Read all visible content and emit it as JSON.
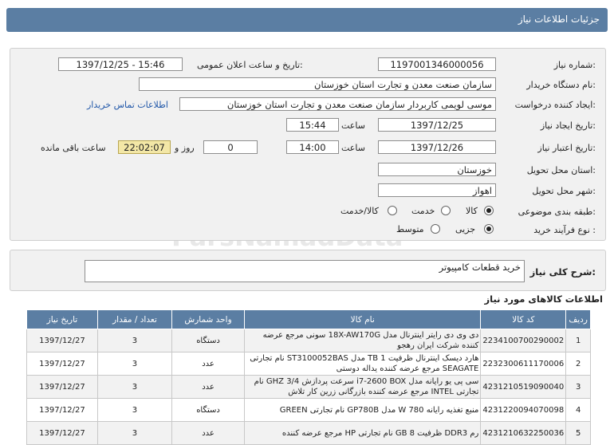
{
  "window_title": "جزئیات اطلاعات نیاز",
  "watermark": "ParsNamadData",
  "fields": {
    "need_number_label": "شماره نیاز:",
    "need_number": "1197001346000056",
    "announce_label": "تاریخ و ساعت اعلان عمومی:",
    "announce_value": "1397/12/25 - 15:46",
    "buyer_label": "نام دستگاه خریدار:",
    "buyer_value": "سازمان صنعت معدن و تجارت استان خوزستان",
    "requester_label": "ایجاد کننده درخواست:",
    "requester_value": "موسی لویمی کاربردار سازمان صنعت معدن و تجارت استان خوزستان",
    "contact_link": "اطلاعات تماس خریدار",
    "created_label": "تاریخ ایجاد نیاز:",
    "created_date": "1397/12/25",
    "time_word": "ساعت",
    "created_time": "15:44",
    "valid_label": "تاریخ اعتبار نیاز:",
    "valid_date": "1397/12/26",
    "valid_time": "14:00",
    "days_value": "0",
    "days_word": "روز و",
    "remaining_time": "22:02:07",
    "remaining_word": "ساعت باقی مانده",
    "province_label": "استان محل تحویل:",
    "province_value": "خوزستان",
    "city_label": "شهر محل تحویل:",
    "city_value": "اهواز",
    "category_label": "طبقه بندی موضوعی:",
    "category_options": [
      "کالا",
      "خدمت",
      "کالا/خدمت"
    ],
    "process_label": "نوع فرآیند خرید :",
    "process_options": [
      "جزیی",
      "متوسط"
    ]
  },
  "summary": {
    "label": "شرح کلی نیاز:",
    "value": "خرید قطعات کامپیوتر"
  },
  "goods": {
    "title": "اطلاعات کالاهای مورد نیاز",
    "headers": [
      "ردیف",
      "کد کالا",
      "نام کالا",
      "واحد شمارش",
      "تعداد / مقدار",
      "تاریخ نیاز"
    ],
    "rows": [
      {
        "idx": "1",
        "code": "2234100700290002",
        "name": "دی وی دی رایتر اینترنال مدل 18X-AW170G سونی مرجع عرضه کننده شرکت ایران رهجو",
        "unit": "دستگاه",
        "qty": "3",
        "date": "1397/12/27"
      },
      {
        "idx": "2",
        "code": "2232300611170006",
        "name": "هارد دیسک اینترنال ظرفیت 1 TB مدل ST3100052BAS نام تجارتی SEAGATE مرجع عرضه کننده یداله دوستی",
        "unit": "عدد",
        "qty": "3",
        "date": "1397/12/27"
      },
      {
        "idx": "3",
        "code": "4231210519090040",
        "name": "سی پی یو رایانه مدل i7-2600 BOX سرعت پردازش 3/4 GHZ نام تجارتی INTEL مرجع عرضه کننده بازرگانی زرین کار تلاش",
        "unit": "عدد",
        "qty": "3",
        "date": "1397/12/27"
      },
      {
        "idx": "4",
        "code": "4231220094070098",
        "name": "منبع تغذیه رایانه 780 W مدل GP780B نام تجارتی GREEN",
        "unit": "دستگاه",
        "qty": "3",
        "date": "1397/12/27"
      },
      {
        "idx": "5",
        "code": "4231210632250036",
        "name": "رم DDR3 ظرفیت 8 GB نام تجارتی HP مرجع عرضه کننده",
        "unit": "عدد",
        "qty": "3",
        "date": "1397/12/27"
      }
    ]
  }
}
